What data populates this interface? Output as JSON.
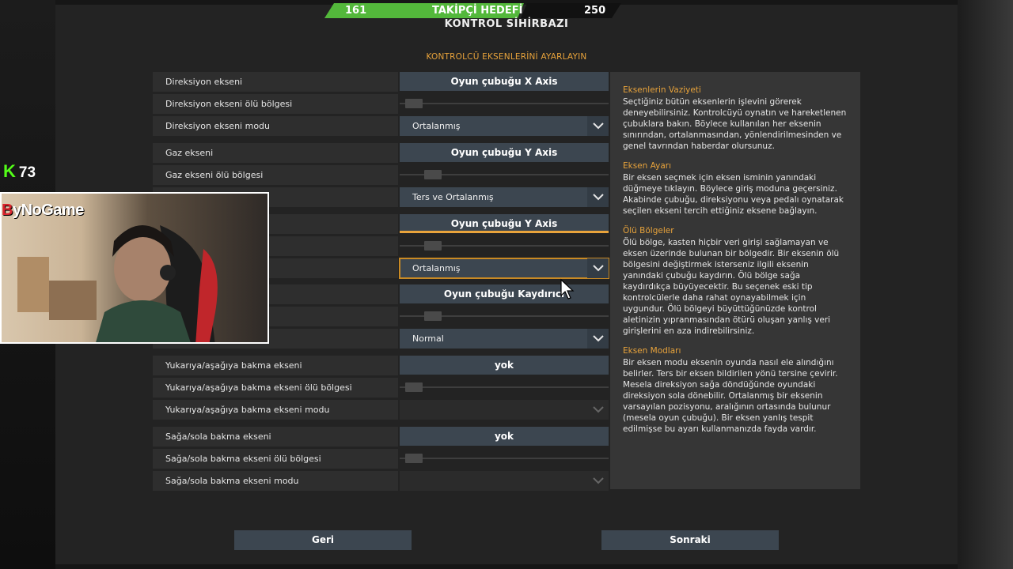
{
  "goal": {
    "start": "161",
    "label": "TAKİPÇİ HEDEFİ",
    "end": "250",
    "progress": 0.67
  },
  "header": {
    "title": "KONTROL SİHİRBAZI",
    "subtitle": "KONTROLCÜ EKSENLERİNİ AYARLAYIN"
  },
  "settings": [
    {
      "label": "Direksiyon ekseni",
      "type": "axis",
      "value": "Oyun çubuğu X Axis"
    },
    {
      "label": "Direksiyon ekseni ölü bölgesi",
      "type": "slider",
      "level": 0.02
    },
    {
      "label": "Direksiyon ekseni modu",
      "type": "select",
      "value": "Ortalanmış"
    },
    {
      "label": "Gaz ekseni",
      "type": "axis",
      "value": "Oyun çubuğu Y Axis"
    },
    {
      "label": "Gaz ekseni ölü bölgesi",
      "type": "slider",
      "level": 0.12
    },
    {
      "label": "",
      "type": "select",
      "value": "Ters ve Ortalanmış"
    },
    {
      "label": "",
      "type": "axis",
      "value": "Oyun çubuğu Y Axis",
      "active": true
    },
    {
      "label": "",
      "type": "slider",
      "level": 0.12
    },
    {
      "label": "",
      "type": "select",
      "value": "Ortalanmış",
      "focused": true
    },
    {
      "label": "",
      "type": "axis",
      "value": "Oyun çubuğu Kaydırıcı"
    },
    {
      "label": "",
      "type": "slider",
      "level": 0.12
    },
    {
      "label": "",
      "type": "select",
      "value": "Normal"
    },
    {
      "label": "Yukarıya/aşağıya bakma ekseni",
      "type": "axis",
      "value": "yok"
    },
    {
      "label": "Yukarıya/aşağıya bakma ekseni ölü bölgesi",
      "type": "slider",
      "level": 0.02
    },
    {
      "label": "Yukarıya/aşağıya bakma ekseni modu",
      "type": "select",
      "value": "",
      "disabled": true
    },
    {
      "label": "Sağa/sola bakma ekseni",
      "type": "axis",
      "value": "yok"
    },
    {
      "label": "Sağa/sola bakma ekseni ölü bölgesi",
      "type": "slider",
      "level": 0.02
    },
    {
      "label": "Sağa/sola bakma ekseni modu",
      "type": "select",
      "value": "",
      "disabled": true
    }
  ],
  "help": [
    {
      "heading": "Eksenlerin Vaziyeti",
      "body": "Seçtiğiniz bütün eksenlerin işlevini görerek deneyebilirsiniz. Kontrolcüyü oynatın ve hareketlenen çubuklara bakın. Böylece kullanılan her eksenin sınırından, ortalanmasından, yönlendirilmesinden ve genel tavrından haberdar olursunuz."
    },
    {
      "heading": "Eksen Ayarı",
      "body": "Bir eksen seçmek için eksen isminin yanındaki düğmeye tıklayın. Böylece giriş moduna geçersiniz. Akabinde çubuğu, direksiyonu veya pedalı oynatarak seçilen ekseni tercih ettiğiniz eksene bağlayın."
    },
    {
      "heading": "Ölü Bölgeler",
      "body": "Ölü bölge, kasten hiçbir veri girişi sağlamayan ve eksen üzerinde bulunan bir bölgedir. Bir eksenin ölü bölgesini değiştirmek isterseniz ilgili eksenin yanındaki çubuğu kaydırın. Ölü bölge sağa kaydırdıkça büyüyecektir. Bu seçenek eski tip kontrolcülerle daha rahat oynayabilmek için uygundur. Ölü bölgeyi büyüttüğünüzde kontrol aletinizin yıpranmasından ötürü oluşan yanlış veri girişlerini en aza indirebilirsiniz."
    },
    {
      "heading": "Eksen Modları",
      "body": "Bir eksen modu eksenin oyunda nasıl ele alındığını belirler. Ters bir eksen bildirilen yönü tersine çevirir. Mesela direksiyon sağa döndüğünde oyundaki direksiyon sola dönebilir. Ortalanmış bir eksenin varsayılan pozisyonu, aralığının ortasında bulunur (mesela oyun çubuğu). Bir eksen yanlış tespit edilmişse bu ayarı kullanmanızda fayda vardır."
    }
  ],
  "nav": {
    "back": "Geri",
    "next": "Sonraki"
  },
  "overlay": {
    "logo_prefix": "B",
    "logo_rest": "yNoGame",
    "kick_count": "73",
    "kick_icon": "K"
  },
  "colors": {
    "accent": "#e8a33b",
    "button": "#3c4650",
    "goal_green": "#53b83b"
  }
}
